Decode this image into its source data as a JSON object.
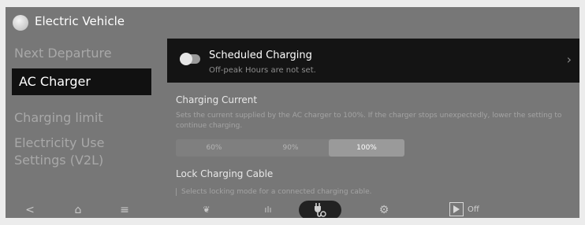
{
  "app": {
    "title": "Electric Vehicle",
    "icon": "ev-app-icon"
  },
  "sidebar": {
    "items": [
      {
        "label": "Next Departure",
        "active": false
      },
      {
        "label": "AC Charger",
        "active": true
      },
      {
        "label": "Charging limit",
        "active": false
      },
      {
        "label": "Electricity Use Settings (V2L)",
        "active": false
      }
    ]
  },
  "scheduled_charging": {
    "title": "Scheduled Charging",
    "subtitle": "Off-peak Hours are not set.",
    "toggle_on": false
  },
  "charging_current": {
    "title": "Charging Current",
    "description": "Sets the current supplied by the AC charger to 100%. If the charger stops unexpectedly, lower the setting to continue charging.",
    "options": [
      "60%",
      "90%",
      "100%"
    ],
    "selected": "100%"
  },
  "lock_cable": {
    "title": "Lock Charging Cable",
    "description": "Selects locking mode for a connected charging cable."
  },
  "navbar": {
    "items": [
      {
        "icon": "back-icon",
        "symbol": "<"
      },
      {
        "icon": "home-icon",
        "symbol": "⌂"
      },
      {
        "icon": "menu-icon",
        "symbol": "≡"
      },
      {
        "icon": "eco-leaf-icon",
        "symbol": "❦"
      },
      {
        "icon": "energy-bars-icon",
        "symbol": "ılı"
      },
      {
        "icon": "ev-charger-icon",
        "symbol": ""
      },
      {
        "icon": "settings-gear-icon",
        "symbol": "⚙"
      }
    ],
    "media_label": "Off"
  }
}
